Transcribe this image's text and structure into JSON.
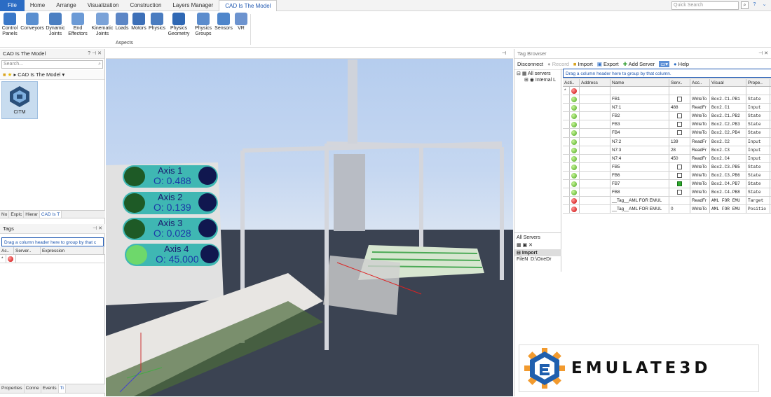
{
  "tabs": [
    "File",
    "Home",
    "Arrange",
    "Visualization",
    "Construction",
    "Layers Manager",
    "CAD Is The Model"
  ],
  "quick_search": {
    "placeholder": "Quick Search"
  },
  "ribbon": {
    "buttons": [
      {
        "label": "Control Panels"
      },
      {
        "label": "Conveyors"
      },
      {
        "label": "Dynamic Joints"
      },
      {
        "label": "End Effectors"
      },
      {
        "label": "Kinematic Joints"
      },
      {
        "label": "Loads"
      },
      {
        "label": "Motors"
      },
      {
        "label": "Physics"
      },
      {
        "label": "Physics Geometry"
      },
      {
        "label": "Physics Groups"
      },
      {
        "label": "Sensors"
      },
      {
        "label": "VR"
      }
    ],
    "group": "Aspects"
  },
  "left_panel": {
    "title": "CAD Is The Model",
    "search_placeholder": "Search...",
    "breadcrumb": "CAD Is The Model",
    "item": "CITM",
    "tabs": [
      "No",
      "Explc",
      "Hierar",
      "CAD Is T"
    ]
  },
  "tags_panel": {
    "title": "Tags",
    "drag_hint": "Drag a column header here to group by that c",
    "columns": [
      "Ac..",
      "Server..",
      "Expression"
    ]
  },
  "bottom_tabs": [
    "Properties",
    "Conne",
    "Events",
    "Ti"
  ],
  "axes": [
    {
      "name": "Axis 1",
      "value": "O: 0.488"
    },
    {
      "name": "Axis 2",
      "value": "O: 0.139"
    },
    {
      "name": "Axis 3",
      "value": "O: 0.028"
    },
    {
      "name": "Axis 4",
      "value": "O: 45.000"
    }
  ],
  "tag_browser": {
    "title": "Tag Browser",
    "toolbar": {
      "disconnect": "Disconnect",
      "record": "Record",
      "import": "Import",
      "export": "Export",
      "add_server": "Add Server",
      "help": "Help"
    },
    "tree": {
      "root": "All servers",
      "child": "Internal L"
    },
    "drag_hint": "Drag a column header here to group by that column.",
    "columns": [
      "Acti..",
      "Address",
      "Name",
      "Serv..",
      "Acc..",
      "Visual",
      "Prope.."
    ],
    "rows": [
      {
        "status": "g",
        "address": "",
        "name": "FB1",
        "server": "",
        "check": false,
        "access": "WriteTo",
        "visual": "Box2.C1.PB1",
        "prop": "State"
      },
      {
        "status": "g",
        "address": "",
        "name": "N7:1",
        "server": "488",
        "check": null,
        "access": "ReadFr",
        "visual": "Box2.C1",
        "prop": "Input"
      },
      {
        "status": "g",
        "address": "",
        "name": "FB2",
        "server": "",
        "check": false,
        "access": "WriteTo",
        "visual": "Box2.C1.PB2",
        "prop": "State"
      },
      {
        "status": "g",
        "address": "",
        "name": "FB3",
        "server": "",
        "check": false,
        "access": "WriteTo",
        "visual": "Box2.C2.PB3",
        "prop": "State"
      },
      {
        "status": "g",
        "address": "",
        "name": "FB4",
        "server": "",
        "check": false,
        "access": "WriteTo",
        "visual": "Box2.C2.PB4",
        "prop": "State"
      },
      {
        "status": "g",
        "address": "",
        "name": "N7:2",
        "server": "139",
        "check": null,
        "access": "ReadFr",
        "visual": "Box2.C2",
        "prop": "Input"
      },
      {
        "status": "g",
        "address": "",
        "name": "N7:3",
        "server": "28",
        "check": null,
        "access": "ReadFr",
        "visual": "Box2.C3",
        "prop": "Input"
      },
      {
        "status": "g",
        "address": "",
        "name": "N7:4",
        "server": "450",
        "check": null,
        "access": "ReadFr",
        "visual": "Box2.C4",
        "prop": "Input"
      },
      {
        "status": "g",
        "address": "",
        "name": "FB5",
        "server": "",
        "check": false,
        "access": "WriteTo",
        "visual": "Box2.C3.PB5",
        "prop": "State"
      },
      {
        "status": "g",
        "address": "",
        "name": "FB6",
        "server": "",
        "check": false,
        "access": "WriteTo",
        "visual": "Box2.C3.PB6",
        "prop": "State"
      },
      {
        "status": "g",
        "address": "",
        "name": "FB7",
        "server": "",
        "check": true,
        "access": "WriteTo",
        "visual": "Box2.C4.PB7",
        "prop": "State"
      },
      {
        "status": "g",
        "address": "",
        "name": "FB8",
        "server": "",
        "check": false,
        "access": "WriteTo",
        "visual": "Box2.C4.PB8",
        "prop": "State"
      },
      {
        "status": "r",
        "address": "",
        "name": "__Tag__AML FOR EMUL",
        "server": "",
        "check": null,
        "access": "ReadFr",
        "visual": "AML FOR EMU",
        "prop": "Target"
      },
      {
        "status": "r",
        "address": "",
        "name": "__Tag__AML FOR EMUL",
        "server": "0",
        "check": null,
        "access": "WriteTo",
        "visual": "AML FOR EMU",
        "prop": "Positio"
      }
    ],
    "all_servers": {
      "title": "All Servers",
      "section": "Import",
      "file_label": "FileN",
      "file_value": "D:\\OneDr"
    }
  },
  "logo_text": "EMULATE3D",
  "colors": {
    "accent": "#2b6cc4",
    "status_green": "#4aa71d",
    "status_red": "#cc0000"
  }
}
